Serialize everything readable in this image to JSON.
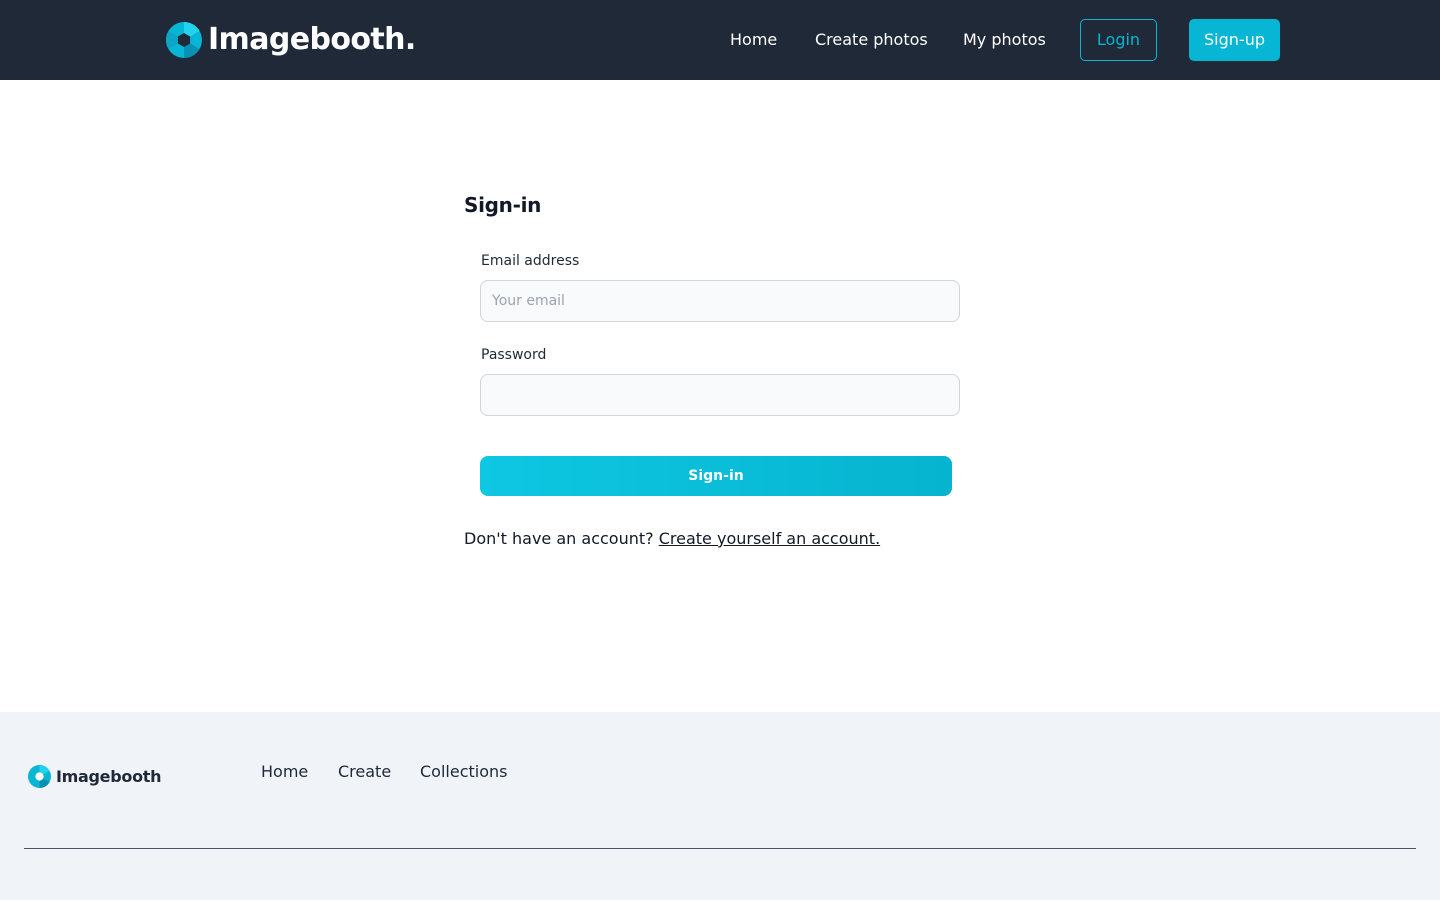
{
  "header": {
    "brand_name": "Imagebooth.",
    "brand_icon": "aperture-logo-icon",
    "nav": [
      {
        "label": "Home"
      },
      {
        "label": "Create photos"
      },
      {
        "label": "My photos"
      }
    ],
    "login_label": "Login",
    "signup_label": "Sign-up"
  },
  "form": {
    "title": "Sign-in",
    "email": {
      "label": "Email address",
      "value": "",
      "placeholder": "Your email"
    },
    "password": {
      "label": "Password",
      "value": "",
      "placeholder": ""
    },
    "submit_label": "Sign-in",
    "account_prompt": "Don't have an account?",
    "account_link": "Create yourself an account."
  },
  "footer": {
    "brand_name": "Imagebooth",
    "brand_icon": "aperture-logo-icon",
    "links": [
      {
        "label": "Home"
      },
      {
        "label": "Create"
      },
      {
        "label": "Collections"
      }
    ]
  },
  "colors": {
    "header_bg": "#1f2937",
    "accent": "#06b6d4",
    "footer_bg": "#f0f3f8"
  }
}
